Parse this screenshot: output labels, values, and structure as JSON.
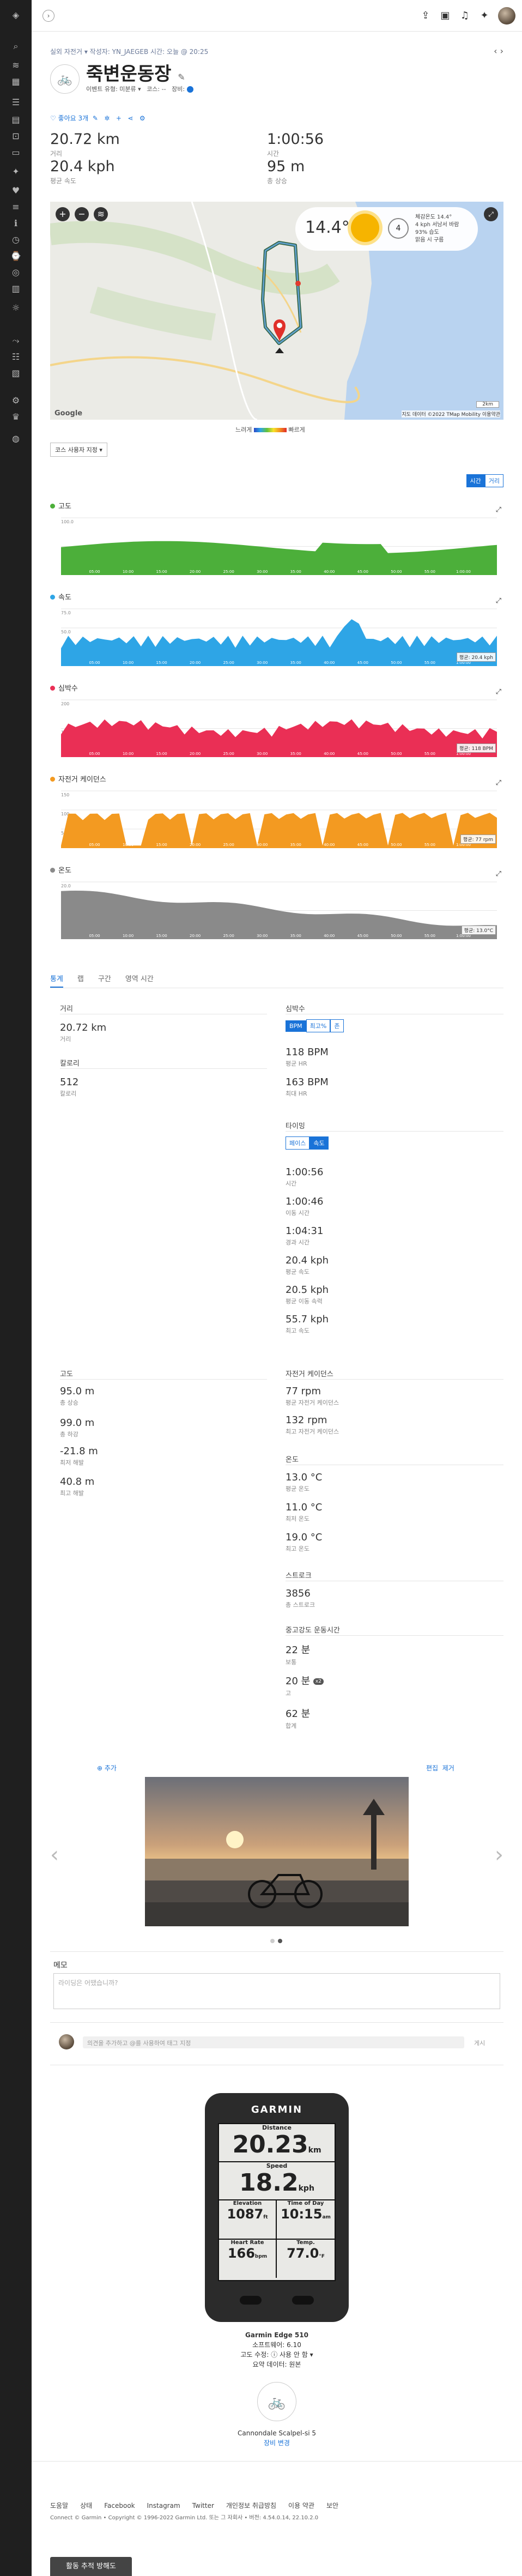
{
  "header": {
    "breadcrumb": "실외 자전거 ▾  작성자: YN_JAEGEB 시간: 오늘 @ 20:25",
    "title": "죽변운동장",
    "sub_desc": "이벤트 유형: 미분류 ▾",
    "sub_course": "코스: --",
    "sub_gear": "장비:",
    "like": "좋아요 3개"
  },
  "summary": [
    {
      "value": "20.72 km",
      "label": "거리"
    },
    {
      "value": "1:00:56",
      "label": "시간"
    },
    {
      "value": "20.4 kph",
      "label": "평균 속도"
    },
    {
      "value": "95 m",
      "label": "총 상승"
    }
  ],
  "map": {
    "weather_temp": "14.4°",
    "weather_lines": [
      "체감온도 14.4°",
      "4 kph 서남서 바람",
      "93% 습도",
      "맑음 시 구름"
    ],
    "legend_slow": "느려게",
    "legend_fast": "빠르게",
    "google": "Google",
    "attribution": "지도 데이터 ©2022 TMap Mobility  이용약관",
    "scale": "2km"
  },
  "similar_btn": "코스 사용자 지정 ▾",
  "toggle": {
    "time": "시간",
    "distance": "거리"
  },
  "charts": [
    {
      "key": "elevation",
      "name": "고도",
      "color": "#4caf3a",
      "badge": "",
      "ticks": [
        "100.0",
        "50.0"
      ]
    },
    {
      "key": "speed",
      "name": "속도",
      "color": "#2ea5e6",
      "badge": "평균: 20.4 kph",
      "ticks": [
        "75.0",
        "50.0",
        "25.0"
      ]
    },
    {
      "key": "hr",
      "name": "심박수",
      "color": "#ea2f55",
      "badge": "평균: 118 BPM",
      "ticks": [
        "200",
        "100"
      ]
    },
    {
      "key": "cadence",
      "name": "자전거 케이던스",
      "color": "#f39a21",
      "badge": "평균: 77 rpm",
      "ticks": [
        "150",
        "100",
        "50"
      ]
    },
    {
      "key": "temp",
      "name": "온도",
      "color": "#8a8a8a",
      "badge": "평균: 13.0°C",
      "ticks": [
        "20.0",
        "10.0"
      ]
    }
  ],
  "chart_time_ticks": [
    "05:00",
    "10:00",
    "15:00",
    "20:00",
    "25:00",
    "30:00",
    "35:00",
    "40:00",
    "45:00",
    "50:00",
    "55:00",
    "1:00:00"
  ],
  "stat_tabs": [
    "통계",
    "랩",
    "구간",
    "영역 시간"
  ],
  "stats_left": {
    "distance_h": "거리",
    "distance": {
      "v": "20.72 km",
      "l": "거리"
    },
    "calories_h": "칼로리",
    "calories": {
      "v": "512",
      "l": "칼로리"
    },
    "elev_h": "고도",
    "elev": [
      {
        "v": "95.0 m",
        "l": "총 상승"
      },
      {
        "v": "99.0 m",
        "l": "총 하강"
      },
      {
        "v": "-21.8 m",
        "l": "최저 해발"
      },
      {
        "v": "40.8 m",
        "l": "최고 해발"
      }
    ]
  },
  "stats_right": {
    "hr_h": "심박수",
    "hr_btns": [
      "BPM",
      "최고%",
      "존"
    ],
    "hr": [
      {
        "v": "118 BPM",
        "l": "평균 HR"
      },
      {
        "v": "163 BPM",
        "l": "최대 HR"
      }
    ],
    "timing_h": "타이밍",
    "timing_btns": [
      "페이스",
      "속도"
    ],
    "timing": [
      {
        "v": "1:00:56",
        "l": "시간"
      },
      {
        "v": "1:00:46",
        "l": "이동 시간"
      },
      {
        "v": "1:04:31",
        "l": "경과 시간"
      },
      {
        "v": "20.4 kph",
        "l": "평균 속도"
      },
      {
        "v": "20.5 kph",
        "l": "평균 이동 속력"
      },
      {
        "v": "55.7 kph",
        "l": "최고 속도"
      }
    ],
    "cad_h": "자전거 케이던스",
    "cad": [
      {
        "v": "77 rpm",
        "l": "평균 자전거 케이던스"
      },
      {
        "v": "132 rpm",
        "l": "최고 자전거 케이던스"
      }
    ],
    "temp_h": "온도",
    "temp": [
      {
        "v": "13.0 °C",
        "l": "평균 온도"
      },
      {
        "v": "11.0 °C",
        "l": "최저 온도"
      },
      {
        "v": "19.0 °C",
        "l": "최고 온도"
      }
    ],
    "stroke_h": "스트로크",
    "stroke": {
      "v": "3856",
      "l": "총 스트로크"
    },
    "intensity_h": "중고강도 운동시간",
    "intensity": [
      {
        "v": "22 분",
        "l": "보통"
      },
      {
        "v": "20 분",
        "l": "고",
        "badge": "x2"
      },
      {
        "v": "62 분",
        "l": "합계"
      }
    ]
  },
  "photo": {
    "add": "⊕ 추가",
    "edit": "편집",
    "remove": "제거"
  },
  "notes": {
    "title": "메모",
    "placeholder": "라이딩은 어땠습니까?"
  },
  "comment": {
    "placeholder": "의견을 추가하고 @를 사용하여 태그 지정",
    "post": "게시"
  },
  "device": {
    "brand": "GARMIN",
    "screen": [
      {
        "l": "Distance",
        "v": "20.23",
        "u": "km"
      },
      {
        "l": "Speed",
        "v": "18.2",
        "u": "kph"
      }
    ],
    "screen_small": [
      {
        "l": "Elevation",
        "v": "1087",
        "u": "ft"
      },
      {
        "l": "Time of Day",
        "v": "10:15",
        "u": "am"
      },
      {
        "l": "Heart Rate",
        "v": "166",
        "u": "bpm"
      },
      {
        "l": "Temp.",
        "v": "77.0",
        "u": "°F"
      }
    ],
    "name": "Garmin Edge 510",
    "software": "소프트웨어: 6.10",
    "altitude": "고도 수정: ⓘ 사용 안 함 ▾",
    "source": "요약 데이터: 원본"
  },
  "gear": {
    "name": "Cannondale Scalpel-si 5",
    "change": "장비 변경"
  },
  "footer": {
    "links": [
      "도움말",
      "상태",
      "Facebook",
      "Instagram",
      "Twitter",
      "개인정보 취급방침",
      "이용 약관",
      "보안"
    ],
    "copyright": "Connect © Garmin • Copyright © 1996-2022 Garmin Ltd. 또는 그 자회사 • 버전: 4.54.0.14, 22.10.2.0",
    "share_btn": "활동 추적 방해도"
  },
  "colors": {
    "accent": "#1a73d8",
    "sidebar": "#1f1f1f"
  }
}
